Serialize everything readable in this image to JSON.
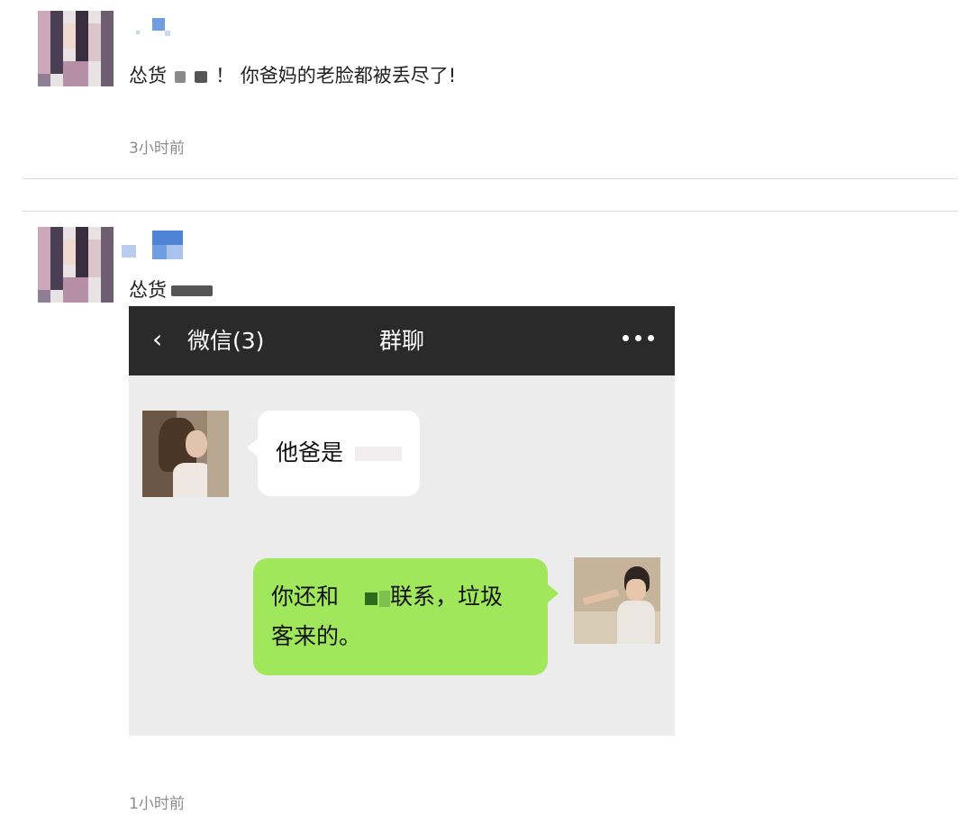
{
  "posts": [
    {
      "author": "",
      "text_prefix": "怂货",
      "text_suffix": "！ 你爸妈的老脸都被丢尽了!",
      "time": "3小时前"
    },
    {
      "author": "",
      "text_prefix": "怂货",
      "time": "1小时前",
      "image": {
        "back_icon": "‹",
        "back_label": "微信(3)",
        "title": "群聊",
        "more_icon": "more-dots-icon",
        "messages": [
          {
            "side": "left",
            "text": "他爸是"
          },
          {
            "side": "right",
            "line1_prefix": "你还和",
            "line1_suffix": "联系，垃圾",
            "line2": "客来的。"
          }
        ]
      }
    }
  ],
  "colors": {
    "chat_header": "#2a2a2a",
    "chat_background": "#ececec",
    "bubble_sent": "#a0e75b",
    "bubble_received": "#ffffff",
    "timestamp": "#8c8c8c"
  }
}
